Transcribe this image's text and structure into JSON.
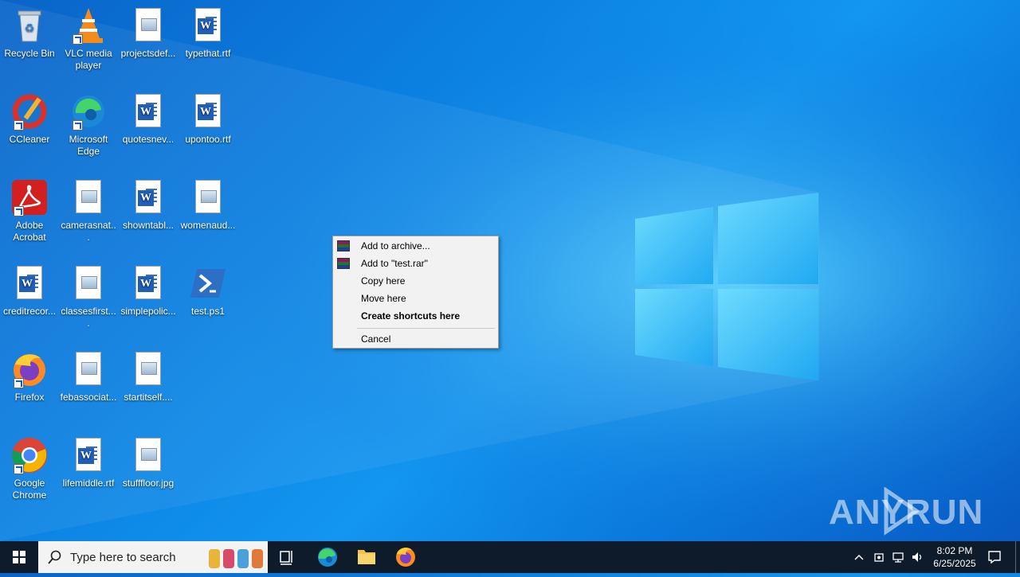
{
  "desktop": {
    "icons": [
      {
        "label": "Recycle Bin",
        "icon": "recycle-bin-icon"
      },
      {
        "label": "VLC media player",
        "icon": "vlc-icon"
      },
      {
        "label": "projectsdef...",
        "icon": "image-file-icon"
      },
      {
        "label": "typethat.rtf",
        "icon": "word-doc-icon"
      },
      {
        "label": "CCleaner",
        "icon": "ccleaner-icon"
      },
      {
        "label": "Microsoft Edge",
        "icon": "edge-icon"
      },
      {
        "label": "quotesnev...",
        "icon": "word-doc-icon"
      },
      {
        "label": "upontoo.rtf",
        "icon": "word-doc-icon"
      },
      {
        "label": "Adobe Acrobat",
        "icon": "acrobat-icon"
      },
      {
        "label": "camerasnat...",
        "icon": "image-file-icon"
      },
      {
        "label": "showntabl...",
        "icon": "word-doc-icon"
      },
      {
        "label": "womenaud...",
        "icon": "image-file-icon"
      },
      {
        "label": "creditrecor...",
        "icon": "word-doc-icon"
      },
      {
        "label": "classesfirst....",
        "icon": "image-file-icon"
      },
      {
        "label": "simplepolic...",
        "icon": "word-doc-icon"
      },
      {
        "label": "test.ps1",
        "icon": "powershell-icon"
      },
      {
        "label": "Firefox",
        "icon": "firefox-icon"
      },
      {
        "label": "febassociat...",
        "icon": "image-file-icon"
      },
      {
        "label": "startitself....",
        "icon": "image-file-icon"
      },
      {
        "label": "Google Chrome",
        "icon": "chrome-icon"
      },
      {
        "label": "lifemiddle.rtf",
        "icon": "word-doc-icon"
      },
      {
        "label": "stufffloor.jpg",
        "icon": "image-file-icon"
      }
    ]
  },
  "context_menu": {
    "items": [
      {
        "label": "Add to archive..."
      },
      {
        "label": "Add to \"test.rar\""
      },
      {
        "label": "Copy here"
      },
      {
        "label": "Move here"
      },
      {
        "label": "Create shortcuts here"
      },
      {
        "label": "Cancel"
      }
    ]
  },
  "taskbar": {
    "search_placeholder": "Type here to search",
    "time": "8:02 PM",
    "date": "6/25/2025"
  },
  "watermark": "ANY RUN",
  "colors": {
    "taskbar": "#0d1b2a",
    "desktop_accent": "#0b7fe0"
  }
}
